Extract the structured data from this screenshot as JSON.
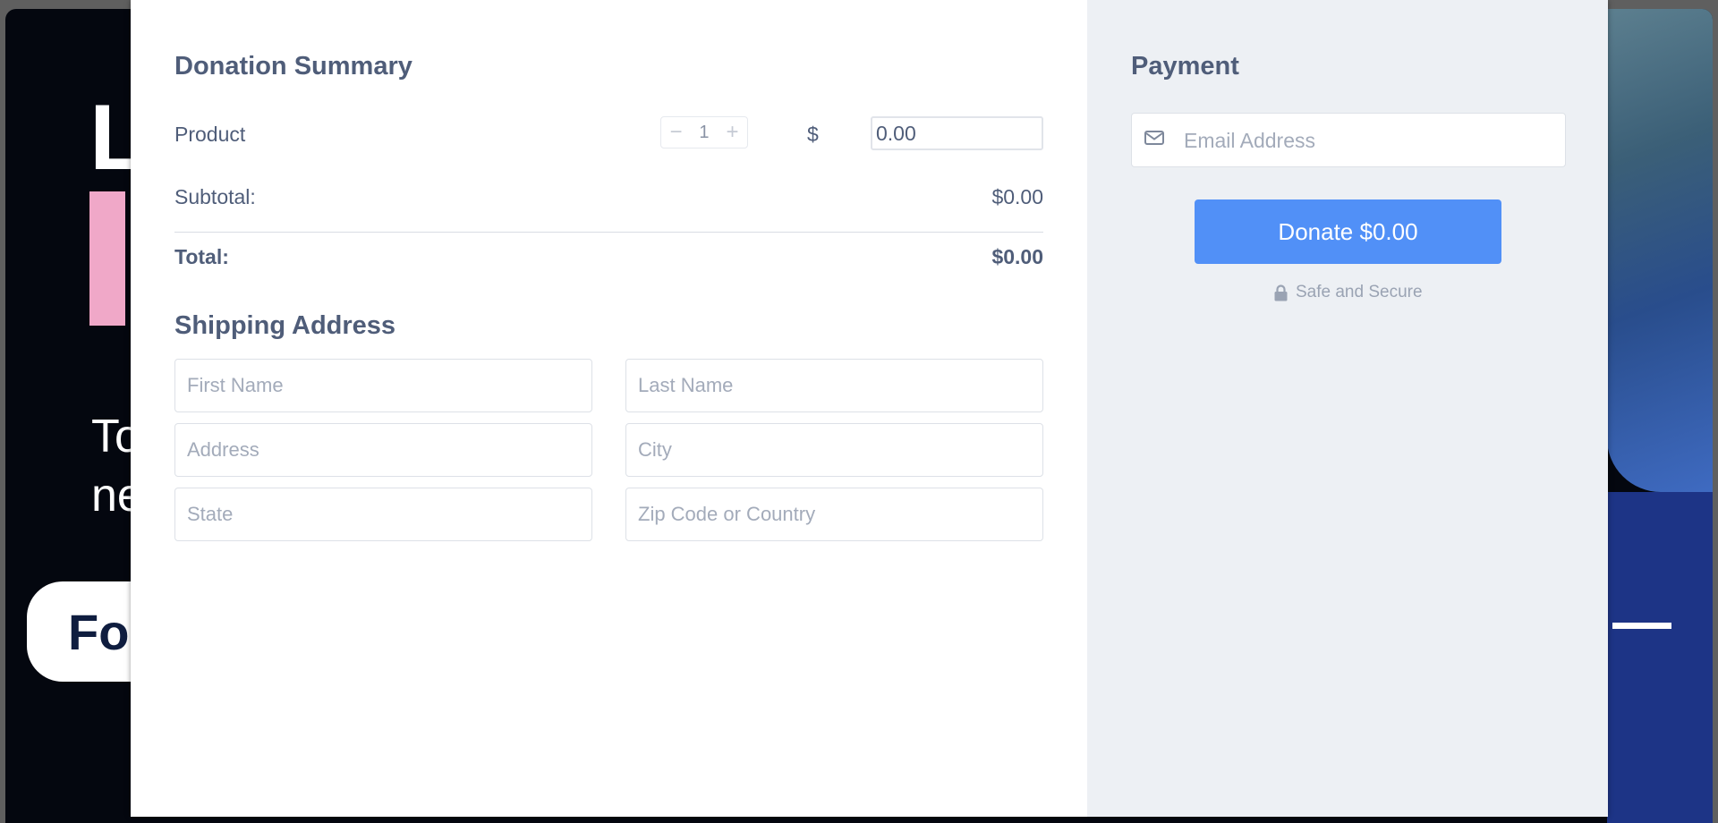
{
  "background": {
    "hero_letter": "L",
    "text_line1": "To",
    "text_line2": "ne",
    "pill_text": "Fo"
  },
  "summary": {
    "title": "Donation Summary",
    "product_label": "Product",
    "quantity": "1",
    "minus_symbol": "−",
    "plus_symbol": "+",
    "currency_symbol": "$",
    "amount_value": "0.00",
    "subtotal_label": "Subtotal:",
    "subtotal_value": "$0.00",
    "total_label": "Total:",
    "total_value": "$0.00"
  },
  "shipping": {
    "title": "Shipping Address",
    "first_name_placeholder": "First Name",
    "last_name_placeholder": "Last Name",
    "address_placeholder": "Address",
    "city_placeholder": "City",
    "state_placeholder": "State",
    "zip_placeholder": "Zip Code or Country"
  },
  "payment": {
    "title": "Payment",
    "email_placeholder": "Email Address",
    "donate_label": "Donate $0.00",
    "secure_label": "Safe and Secure",
    "email_icon": "envelope-icon",
    "lock_icon": "lock-icon"
  },
  "colors": {
    "accent": "#5190f7",
    "text": "#4f5d79",
    "panel": "#edf0f4"
  }
}
